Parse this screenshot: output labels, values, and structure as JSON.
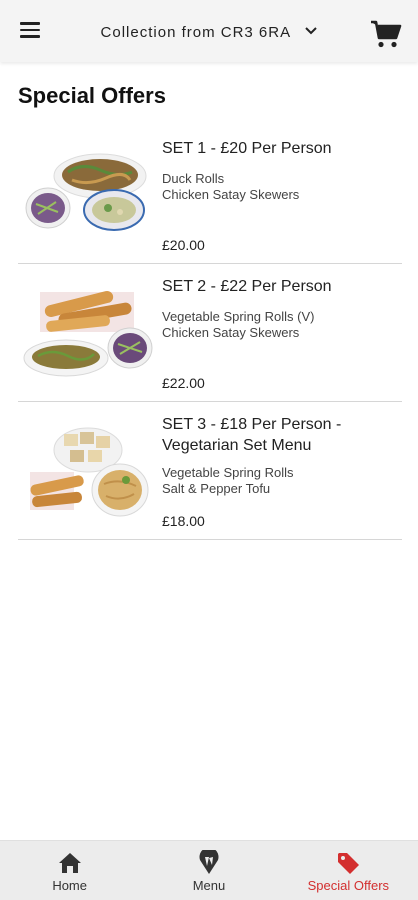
{
  "header": {
    "location_label": "Collection from CR3 6RA"
  },
  "page": {
    "title": "Special Offers"
  },
  "offers": [
    {
      "title": "SET 1 - £20 Per Person",
      "items": [
        "Duck Rolls",
        "Chicken Satay Skewers"
      ],
      "price": "£20.00"
    },
    {
      "title": "SET 2 - £22 Per Person",
      "items": [
        "Vegetable Spring Rolls (V)",
        "Chicken Satay Skewers"
      ],
      "price": "£22.00"
    },
    {
      "title": "SET 3 - £18 Per Person - Vegetarian Set Menu",
      "items": [
        "Vegetable Spring Rolls",
        "Salt & Pepper Tofu"
      ],
      "price": "£18.00"
    }
  ],
  "bottom_nav": [
    {
      "label": "Home",
      "icon": "home-icon",
      "active": false
    },
    {
      "label": "Menu",
      "icon": "menu-pin-icon",
      "active": false
    },
    {
      "label": "Special Offers",
      "icon": "tag-icon",
      "active": true
    }
  ],
  "colors": {
    "accent": "#d32f2f",
    "topbar": "#f4f4f4",
    "bottom_nav": "#ececec"
  }
}
